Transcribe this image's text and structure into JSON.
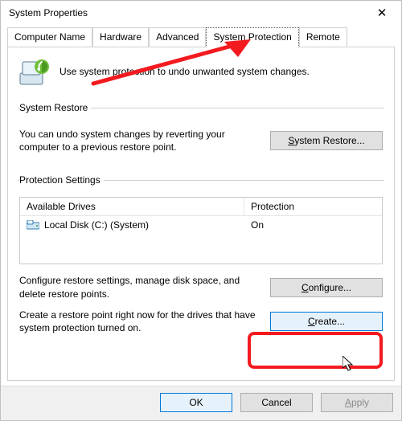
{
  "window": {
    "title": "System Properties",
    "close_glyph": "✕"
  },
  "tabs": [
    {
      "label": "Computer Name"
    },
    {
      "label": "Hardware"
    },
    {
      "label": "Advanced"
    },
    {
      "label": "System Protection"
    },
    {
      "label": "Remote"
    }
  ],
  "active_tab_index": 3,
  "intro_text": "Use system protection to undo unwanted system changes.",
  "system_restore": {
    "legend": "System Restore",
    "text": "You can undo system changes by reverting your computer to a previous restore point.",
    "button_prefix": "S",
    "button_rest": "ystem Restore..."
  },
  "protection": {
    "legend": "Protection Settings",
    "columns": {
      "a": "Available Drives",
      "b": "Protection"
    },
    "drives": [
      {
        "name": "Local Disk (C:) (System)",
        "protection": "On",
        "icon": "drive-icon"
      }
    ],
    "configure_text": "Configure restore settings, manage disk space, and delete restore points.",
    "configure_prefix": "C",
    "configure_rest": "onfigure...",
    "create_text": "Create a restore point right now for the drives that have system protection turned on.",
    "create_prefix": "C",
    "create_rest": "reate..."
  },
  "dialog_buttons": {
    "ok": "OK",
    "cancel": "Cancel",
    "apply_prefix": "A",
    "apply_rest": "pply"
  },
  "annotations": {
    "arrow_color": "#f31a1f",
    "rect_color": "#f31a1f"
  }
}
